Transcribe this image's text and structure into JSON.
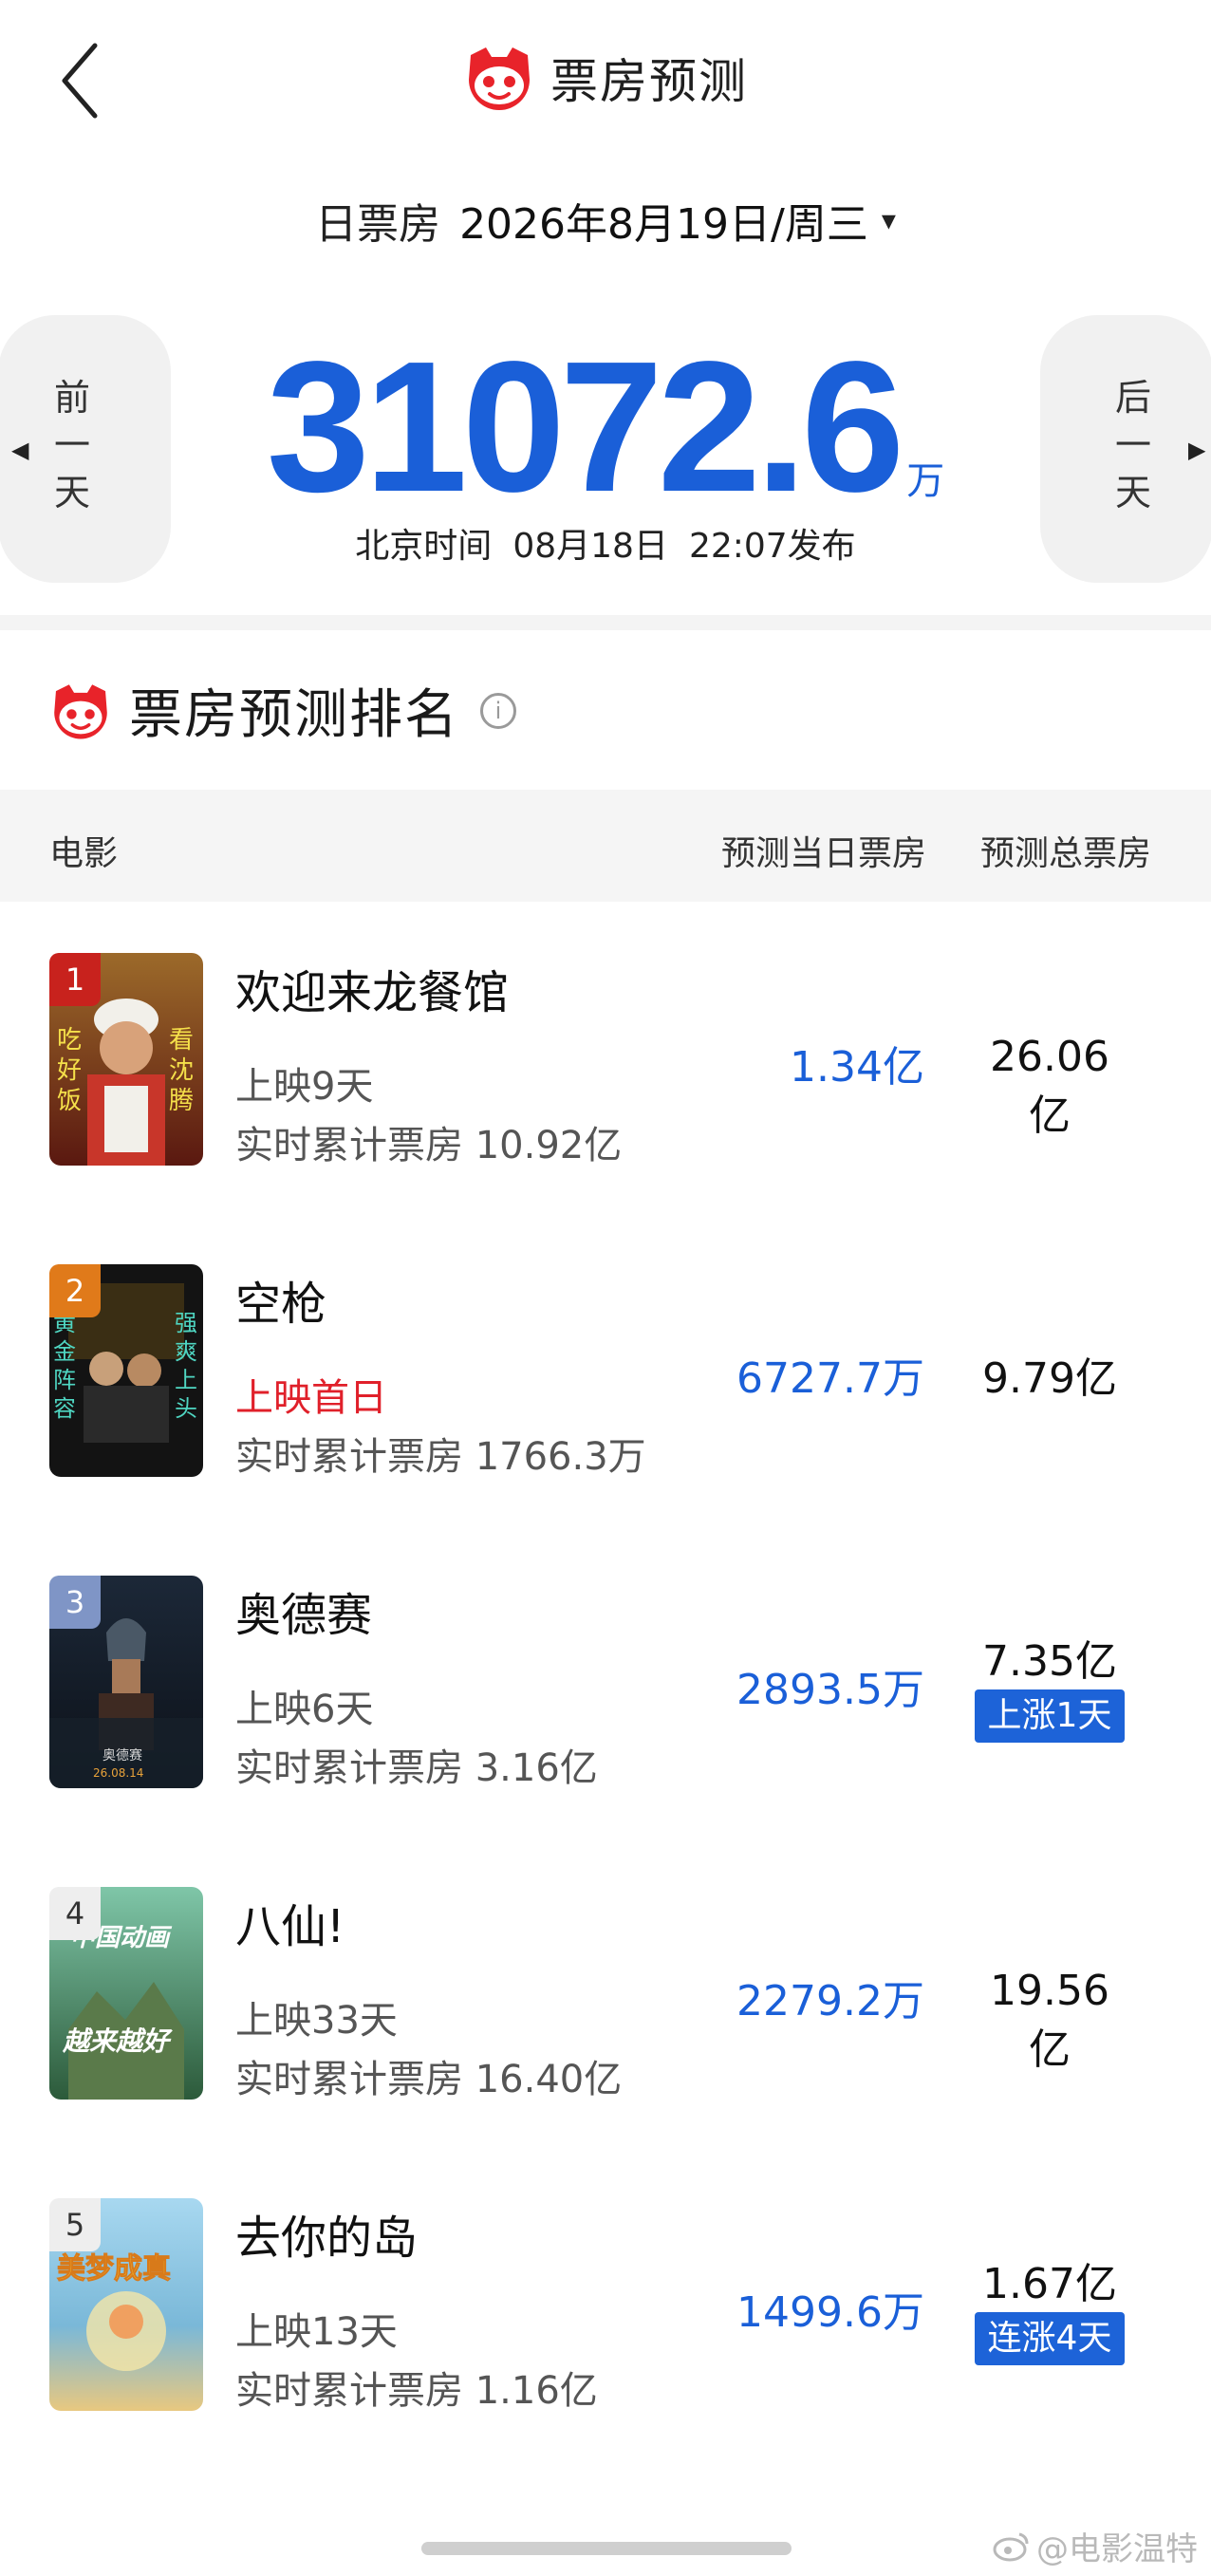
{
  "header": {
    "title": "票房预测",
    "date_label": "日票房",
    "date_value": "2026年8月19日/周三",
    "date_caret": "▾"
  },
  "summary": {
    "prev_label": "前一天",
    "next_label": "后一天",
    "total_value": "31072.6",
    "total_unit": "万",
    "publish_tz": "北京时间",
    "publish_date": "08月18日",
    "publish_time": "22:07发布"
  },
  "ranking": {
    "title": "票房预测排名",
    "col_movie": "电影",
    "col_day": "预测当日票房",
    "col_total": "预测总票房",
    "movies": [
      {
        "rank": "1",
        "title": "欢迎来龙餐馆",
        "release": "上映9天",
        "cum": "实时累计票房 10.92亿",
        "day": "1.34亿",
        "total": "26.06亿",
        "badge": "",
        "badge_color": "#c8221d"
      },
      {
        "rank": "2",
        "title": "空枪",
        "release": "上映首日",
        "cum": "实时累计票房 1766.3万",
        "day": "6727.7万",
        "total": "9.79亿",
        "badge": "",
        "badge_color": "#e07a1a"
      },
      {
        "rank": "3",
        "title": "奥德赛",
        "release": "上映6天",
        "cum": "实时累计票房 3.16亿",
        "day": "2893.5万",
        "total": "7.35亿",
        "badge": "上涨1天",
        "badge_color": "#7f95c6"
      },
      {
        "rank": "4",
        "title": "八仙!",
        "release": "上映33天",
        "cum": "实时累计票房 16.40亿",
        "day": "2279.2万",
        "total": "19.56亿",
        "badge": "",
        "badge_color": "#d8d8d8"
      },
      {
        "rank": "5",
        "title": "去你的岛",
        "release": "上映13天",
        "cum": "实时累计票房 1.16亿",
        "day": "1499.6万",
        "total": "1.67亿",
        "badge": "连涨4天",
        "badge_color": "#d8d8d8"
      }
    ]
  },
  "watermark": "@电影温特",
  "colors": {
    "accent_blue": "#1a5fd8",
    "first_day_red": "#e0202a",
    "badge_blue": "#1d63d8"
  }
}
